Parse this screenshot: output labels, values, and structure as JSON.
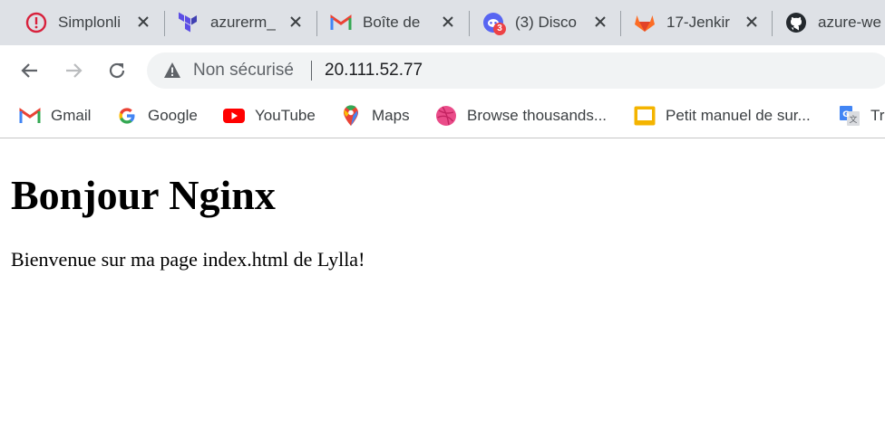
{
  "tabs": [
    {
      "title": "Simplonli",
      "icon": "simplon-icon"
    },
    {
      "title": "azurerm_",
      "icon": "terraform-icon"
    },
    {
      "title": "Boîte de",
      "icon": "gmail-icon"
    },
    {
      "title": "(3) Disco",
      "icon": "discord-icon",
      "badge": "3"
    },
    {
      "title": "17-Jenkir",
      "icon": "gitlab-icon"
    },
    {
      "title": "azure-we",
      "icon": "github-icon"
    }
  ],
  "omnibox": {
    "security_label": "Non sécurisé",
    "url": "20.111.52.77"
  },
  "bookmarks": [
    {
      "label": "Gmail",
      "icon": "gmail-icon"
    },
    {
      "label": "Google",
      "icon": "google-icon"
    },
    {
      "label": "YouTube",
      "icon": "youtube-icon"
    },
    {
      "label": "Maps",
      "icon": "maps-icon"
    },
    {
      "label": "Browse thousands...",
      "icon": "dribbble-icon"
    },
    {
      "label": "Petit manuel de sur...",
      "icon": "slides-icon"
    },
    {
      "label": "Tr",
      "icon": "translate-icon"
    }
  ],
  "page": {
    "heading": "Bonjour Nginx",
    "paragraph": "Bienvenue sur ma page index.html de Lylla!"
  },
  "colors": {
    "tabstrip": "#dee1e6",
    "omnibox": "#f1f3f4",
    "simplon": "#d8213c",
    "terraform": "#5c4ee5",
    "discord": "#5865f2",
    "gitlab": "#e24329",
    "youtube": "#ff0000",
    "dribbble": "#ea4c89",
    "slides": "#f4b400"
  }
}
